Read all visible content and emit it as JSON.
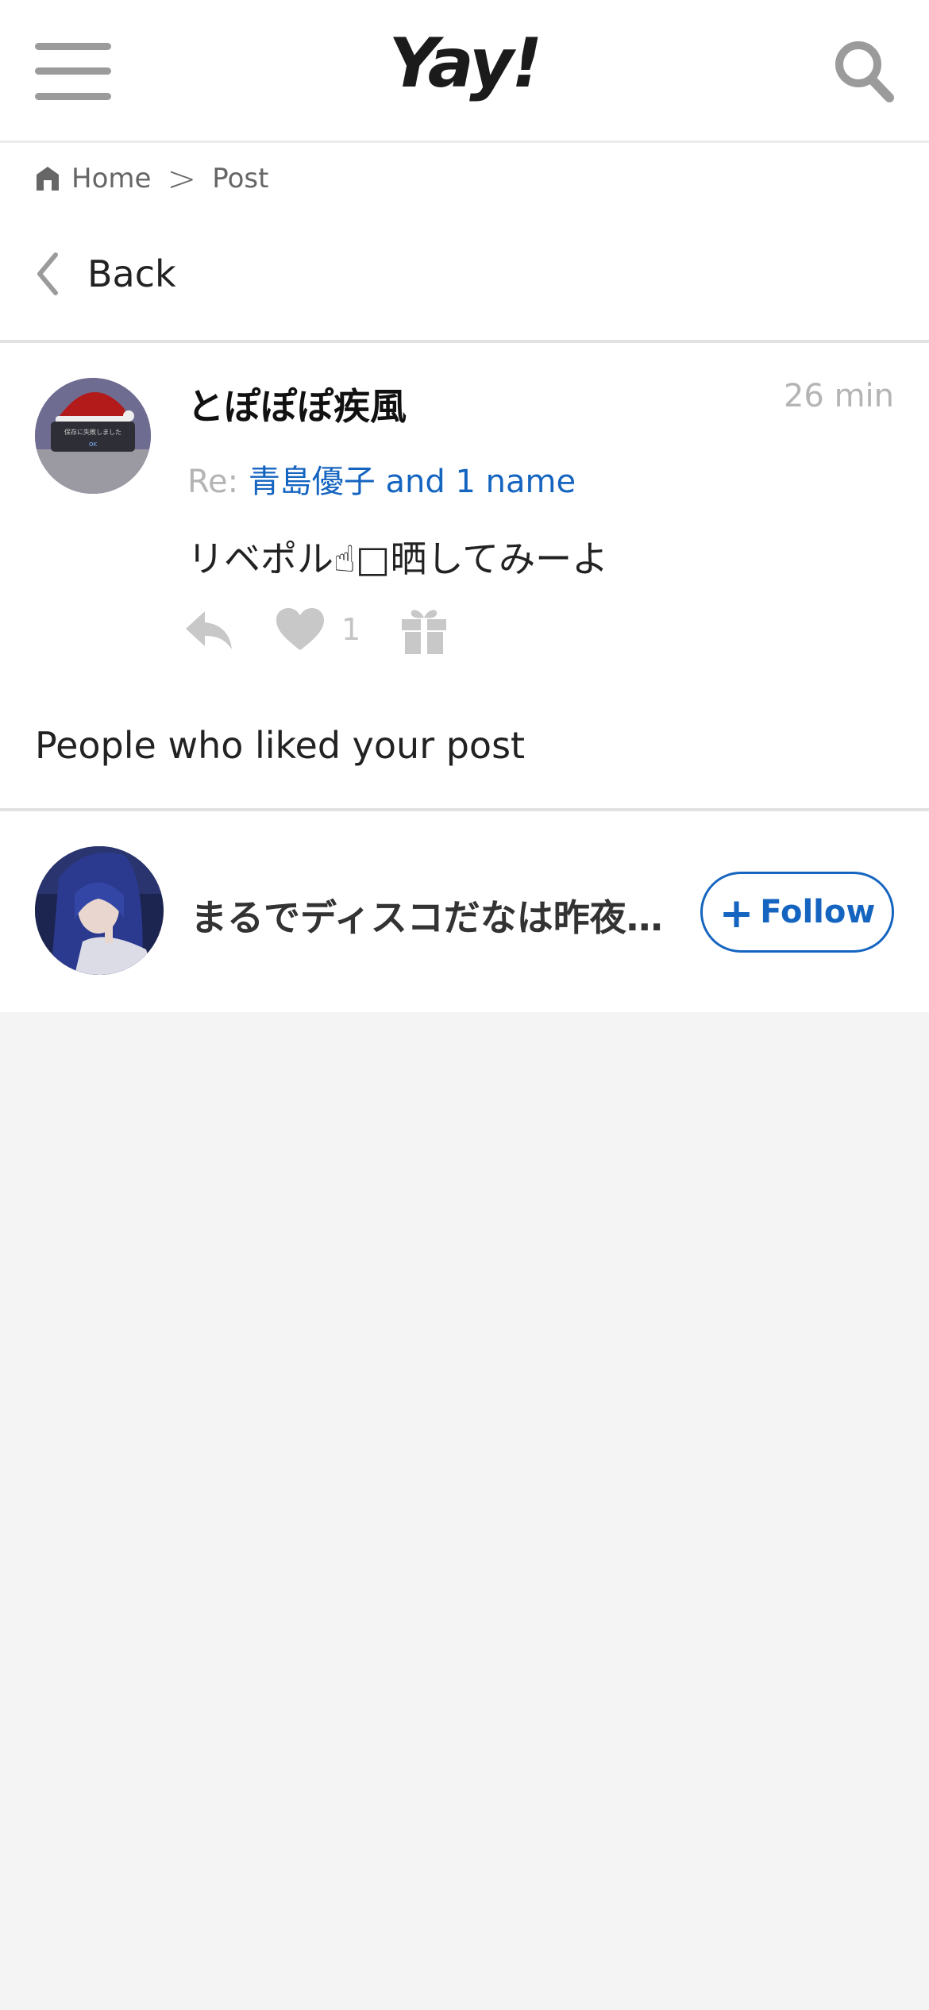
{
  "header": {
    "logo": "Yay!",
    "menu_icon": "hamburger-menu-icon",
    "search_icon": "search-icon"
  },
  "breadcrumb": {
    "home": "Home",
    "separator": ">",
    "current": "Post"
  },
  "back": {
    "label": "Back"
  },
  "post": {
    "author": "とぽぽぽ疾風",
    "time": "26 min",
    "reply_prefix": "Re:",
    "reply_target": "青島優子 and 1 name",
    "body": "リベポル☝︎□晒してみーよ",
    "like_count": "1",
    "avatar_text": "保存に失敗しました",
    "avatar_button": "OK"
  },
  "liked_section": {
    "title": "People who liked your post"
  },
  "likers": [
    {
      "name": "まるでディスコだなは昨夜…",
      "follow_label": "Follow",
      "follow_plus": "+"
    }
  ],
  "colors": {
    "accent": "#1565c0",
    "muted": "#b4b4b4",
    "background": "#f4f4f4"
  }
}
